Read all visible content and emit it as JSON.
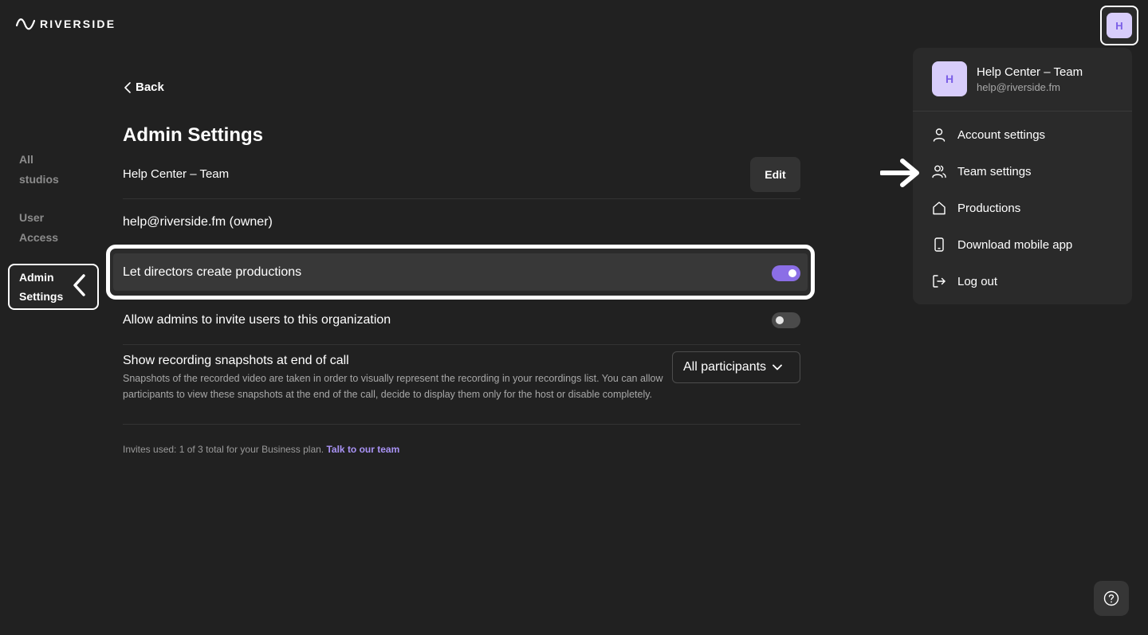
{
  "brand": {
    "logo_text": "RIVERSIDE"
  },
  "header": {
    "avatar_initial": "H"
  },
  "sidebar": {
    "items": [
      {
        "label_line1": "All",
        "label_line2": "studios"
      },
      {
        "label_line1": "User",
        "label_line2": "Access"
      },
      {
        "label_line1": "Admin",
        "label_line2": "Settings",
        "active": true
      }
    ]
  },
  "main": {
    "back_label": "Back",
    "title": "Admin Settings",
    "team_name": "Help Center – Team",
    "edit_label": "Edit",
    "owner_text": "help@riverside.fm (owner)",
    "settings": [
      {
        "label": "Let directors create productions",
        "enabled": true
      },
      {
        "label": "Allow admins to invite users to this organization",
        "enabled": false
      }
    ],
    "snapshots": {
      "title": "Show recording snapshots at end of call",
      "description": "Snapshots of the recorded video are taken in order to visually represent the recording in your recordings list. You can allow participants to view these snapshots at the end of the call, decide to display them only for the host or disable completely.",
      "selected_option": "All participants"
    },
    "footer_note": "Invites used: 1 of 3 total for your Business plan.",
    "footer_link": "Talk to our team"
  },
  "menu": {
    "avatar_initial": "H",
    "name": "Help Center – Team",
    "email": "help@riverside.fm",
    "items": [
      {
        "label": "Account settings",
        "icon": "user-icon"
      },
      {
        "label": "Team settings",
        "icon": "team-icon"
      },
      {
        "label": "Productions",
        "icon": "home-icon"
      },
      {
        "label": "Download mobile app",
        "icon": "phone-icon"
      },
      {
        "label": "Log out",
        "icon": "logout-icon"
      }
    ]
  },
  "colors": {
    "background": "#212121",
    "accent": "#8b6ee6",
    "link": "#a993f5",
    "avatar_bg": "#d8cdfb"
  }
}
